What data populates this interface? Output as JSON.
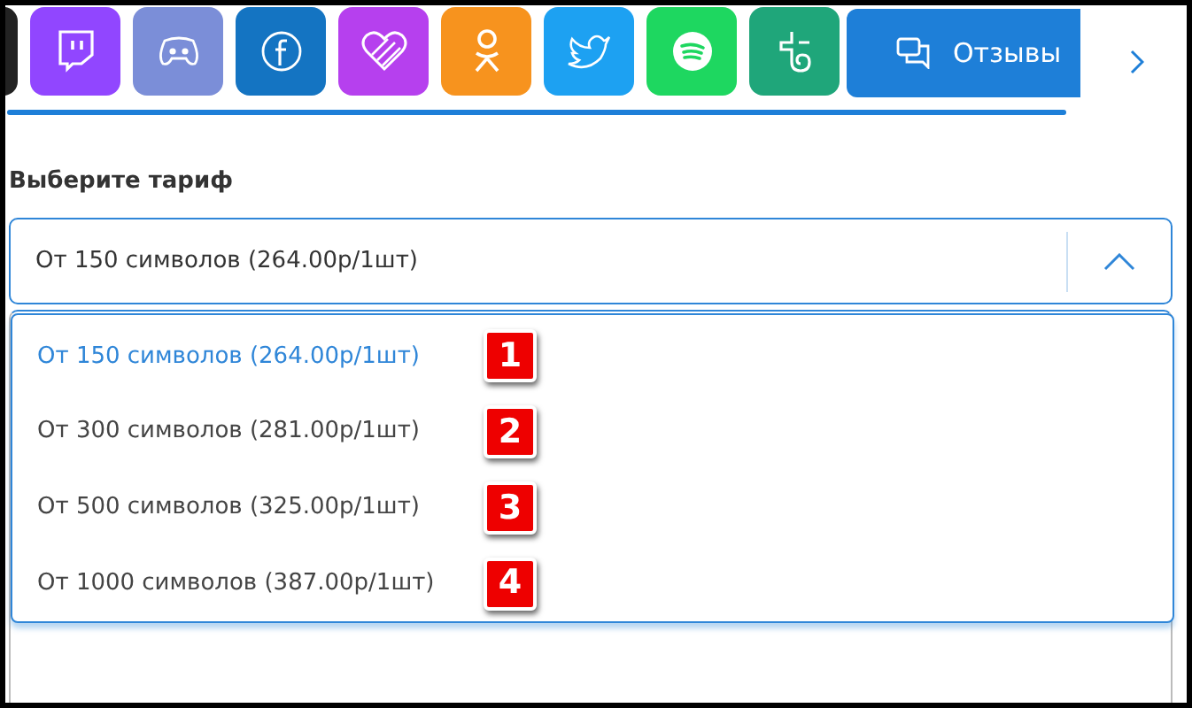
{
  "tiles": [
    {
      "kind": "cut",
      "color": "#222222"
    },
    {
      "kind": "tv",
      "color": "#9146ff"
    },
    {
      "kind": "gamepad",
      "color": "#7b8ed8"
    },
    {
      "kind": "f-circle",
      "color": "#1474c2"
    },
    {
      "kind": "heart",
      "color": "#b640ee"
    },
    {
      "kind": "figure",
      "color": "#f7931e"
    },
    {
      "kind": "bird",
      "color": "#1da1f2"
    },
    {
      "kind": "waves",
      "color": "#1ed760"
    },
    {
      "kind": "hook",
      "color": "#1fa67a"
    }
  ],
  "reviews_button": {
    "label": "Отзывы"
  },
  "tariff": {
    "label": "Выберите тариф",
    "value": "От 150 символов (264.00р/1шт)",
    "expanded": true,
    "options": [
      {
        "label": "От 150 символов (264.00р/1шт)",
        "selected": true,
        "badge": "1"
      },
      {
        "label": "От 300 символов (281.00р/1шт)",
        "selected": false,
        "badge": "2"
      },
      {
        "label": "От 500 символов (325.00р/1шт)",
        "selected": false,
        "badge": "3"
      },
      {
        "label": "От 1000 символов (387.00р/1шт)",
        "selected": false,
        "badge": "4"
      }
    ]
  }
}
